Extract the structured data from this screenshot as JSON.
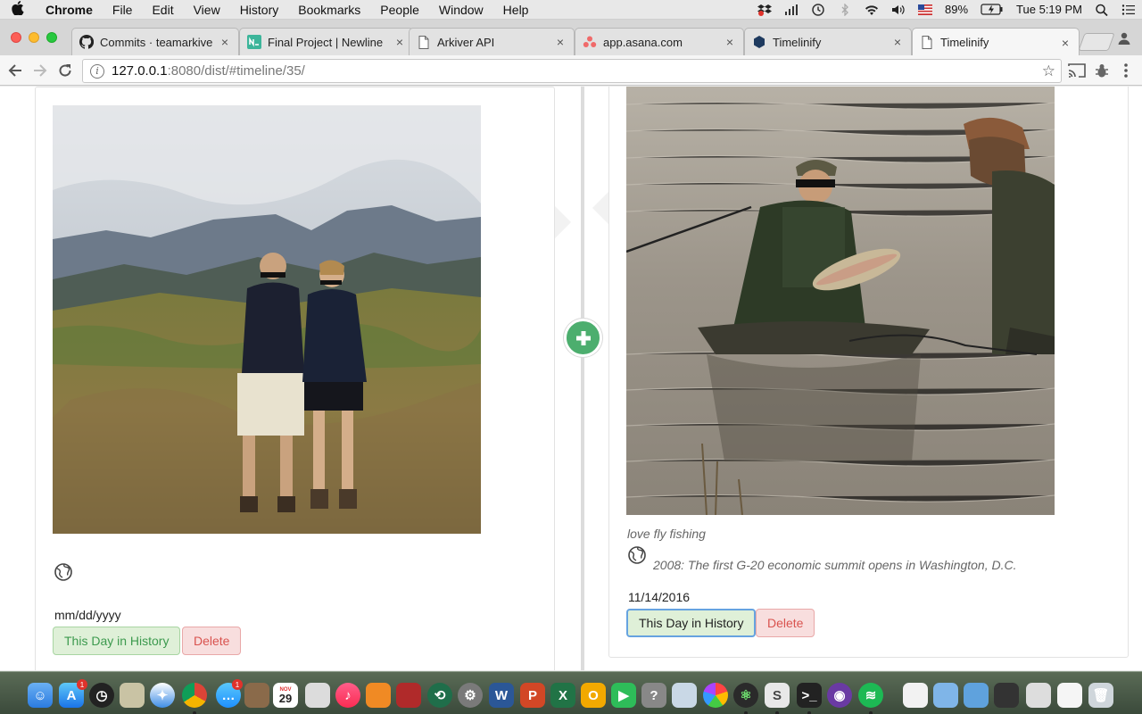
{
  "menubar": {
    "app_name": "Chrome",
    "items": [
      "File",
      "Edit",
      "View",
      "History",
      "Bookmarks",
      "People",
      "Window",
      "Help"
    ],
    "battery": "89%",
    "clock": "Tue 5:19 PM"
  },
  "tabs": [
    {
      "label": "Commits · teamarkiver/",
      "icon": "github-icon"
    },
    {
      "label": "Final Project | Newline",
      "icon": "newline-icon"
    },
    {
      "label": "Arkiver API",
      "icon": "page-icon"
    },
    {
      "label": "app.asana.com",
      "icon": "asana-icon"
    },
    {
      "label": "Timelinify",
      "icon": "timelinify-icon"
    },
    {
      "label": "Timelinify",
      "icon": "page-icon"
    }
  ],
  "tab_close_glyph": "×",
  "address": {
    "host": "127.0.0.1",
    "rest": ":8080/dist/#timeline/35/"
  },
  "timeline": {
    "left_card": {
      "date": "mm/dd/yyyy",
      "history_button": "This Day in History",
      "delete_button": "Delete"
    },
    "right_card": {
      "caption": "love fly fishing",
      "fact": "2008: The first G-20 economic summit opens in Washington, D.C.",
      "date": "11/14/2016",
      "history_button": "This Day in History",
      "delete_button": "Delete"
    }
  },
  "dock": {
    "calendar_month": "NOV",
    "calendar_day": "29",
    "badges": [
      "1",
      "1"
    ]
  },
  "colors": {
    "add_button": "#4cae6e",
    "history_button_bg": "#dff0d8",
    "history_button_text": "#3c763d",
    "delete_text": "#d9534f"
  }
}
